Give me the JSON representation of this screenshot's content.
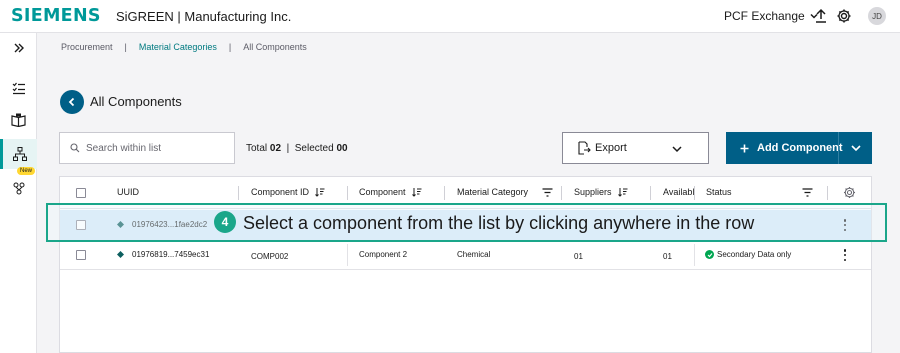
{
  "topbar": {
    "brand": "SIEMENS",
    "app_title": "SiGREEN | Manufacturing Inc.",
    "exchange_label": "PCF Exchange",
    "avatar_initials": "JD"
  },
  "breadcrumb": {
    "items": [
      "Procurement",
      "Material Categories",
      "All Components"
    ],
    "separator": "|"
  },
  "page": {
    "title": "All Components"
  },
  "toolbar": {
    "search_placeholder": "Search within list",
    "total_label": "Total",
    "total_value": "02",
    "selected_label": "Selected",
    "selected_value": "00",
    "export_label": "Export",
    "add_label": "Add Component"
  },
  "table": {
    "headers": {
      "uuid": "UUID",
      "component_id": "Component ID",
      "component": "Component",
      "material_category": "Material Category",
      "suppliers": "Suppliers",
      "availability": "Availabl",
      "status": "Status"
    },
    "rows": [
      {
        "uuid": "01976423...1fae2dc2",
        "component_id": "",
        "component": "",
        "material_category": "",
        "suppliers": "",
        "availability": "",
        "status": ""
      },
      {
        "uuid": "01976819...7459ec31",
        "component_id": "COMP002",
        "component": "Component 2",
        "material_category": "Chemical",
        "suppliers": "01",
        "availability": "01",
        "status": "Secondary Data only"
      }
    ]
  },
  "overlay": {
    "step": "4",
    "instruction": "Select a component from the list by clicking anywhere in the row"
  },
  "rail": {
    "new_badge": "New"
  },
  "colors": {
    "brand": "#009999",
    "primary": "#005f87",
    "highlight": "#d4e9f7",
    "callout": "#1aa68a",
    "status_ok": "#00a651"
  }
}
